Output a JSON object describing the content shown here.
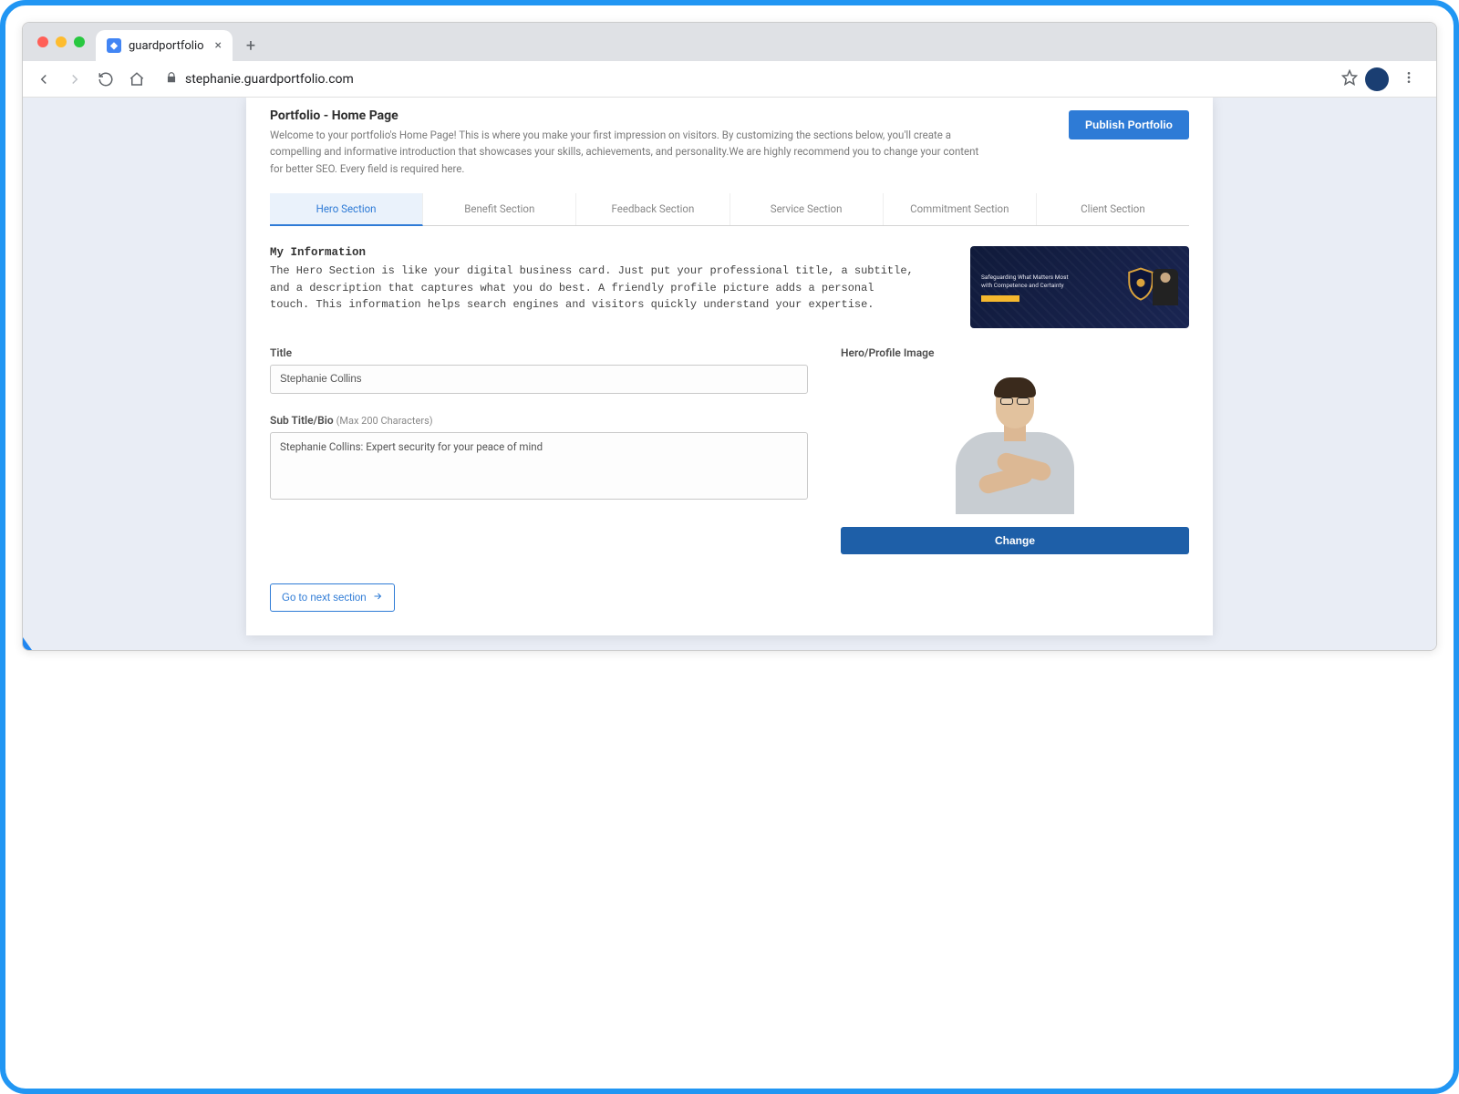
{
  "browser": {
    "tab_title": "guardportfolio",
    "url": "stephanie.guardportfolio.com"
  },
  "page": {
    "title": "Portfolio - Home Page",
    "description": "Welcome to your portfolio's Home Page! This is where you make your first impression on visitors. By customizing the sections below, you'll create a compelling and informative introduction that showcases your skills, achievements, and personality.We are highly recommend you to change your content for better SEO. Every field is required here.",
    "publish_label": "Publish Portfolio"
  },
  "tabs": [
    {
      "label": "Hero Section",
      "active": true
    },
    {
      "label": "Benefit Section",
      "active": false
    },
    {
      "label": "Feedback Section",
      "active": false
    },
    {
      "label": "Service Section",
      "active": false
    },
    {
      "label": "Commitment Section",
      "active": false
    },
    {
      "label": "Client Section",
      "active": false
    }
  ],
  "hero": {
    "heading": "My Information",
    "description": "The Hero Section is like your digital business card. Just put your professional title, a subtitle, and a description that captures what you do best. A friendly profile picture adds a personal touch. This information helps search engines and visitors quickly understand your expertise.",
    "title_label": "Title",
    "title_value": "Stephanie Collins",
    "subtitle_label": "Sub Title/Bio",
    "subtitle_hint": "(Max 200 Characters)",
    "subtitle_value": "Stephanie Collins: Expert security for your peace of mind",
    "image_label": "Hero/Profile Image",
    "change_label": "Change",
    "preview_line1": "Safeguarding What Matters Most",
    "preview_line2": "with Competence and Certainty"
  },
  "actions": {
    "next_section_label": "Go to next section"
  }
}
